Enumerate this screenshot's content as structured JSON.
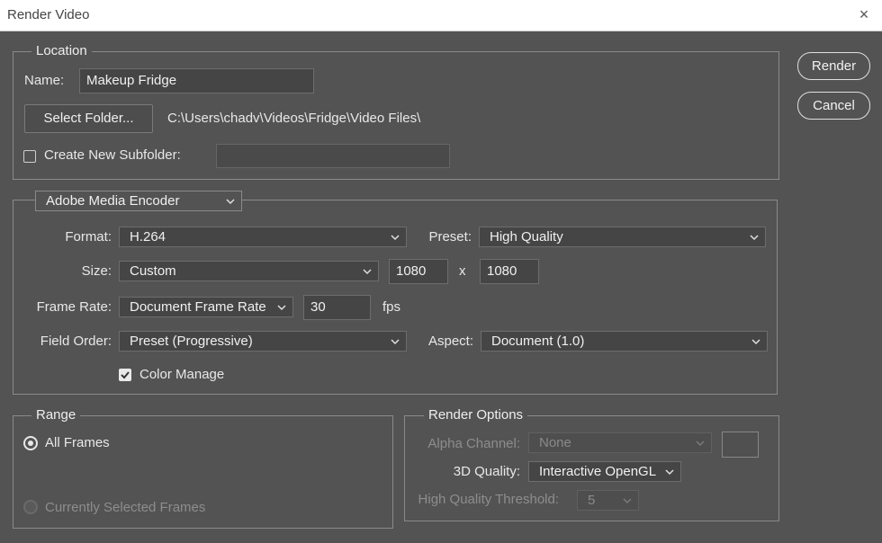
{
  "window": {
    "title": "Render Video",
    "close_glyph": "×"
  },
  "buttons": {
    "render": "Render",
    "cancel": "Cancel"
  },
  "location": {
    "legend": "Location",
    "name_label": "Name:",
    "name_value": "Makeup Fridge",
    "select_folder": "Select Folder...",
    "folder_path": "C:\\Users\\chadv\\Videos\\Fridge\\Video Files\\",
    "subfolder_label": "Create New Subfolder:",
    "subfolder_checked": false,
    "subfolder_value": ""
  },
  "encoder": {
    "selected": "Adobe Media Encoder",
    "format_label": "Format:",
    "format_value": "H.264",
    "preset_label": "Preset:",
    "preset_value": "High Quality",
    "size_label": "Size:",
    "size_value": "Custom",
    "width": "1080",
    "by": "x",
    "height": "1080",
    "frame_rate_label": "Frame Rate:",
    "frame_rate_value": "Document Frame Rate",
    "fps_value": "30",
    "fps_unit": "fps",
    "field_order_label": "Field Order:",
    "field_order_value": "Preset (Progressive)",
    "aspect_label": "Aspect:",
    "aspect_value": "Document (1.0)",
    "color_manage_label": "Color Manage",
    "color_manage_checked": true
  },
  "range": {
    "legend": "Range",
    "all_frames": "All Frames",
    "selected_frames": "Currently Selected Frames",
    "selected_option": "All Frames"
  },
  "render_options": {
    "legend": "Render Options",
    "alpha_label": "Alpha Channel:",
    "alpha_value": "None",
    "quality_label": "3D Quality:",
    "quality_value": "Interactive OpenGL",
    "threshold_label": "High Quality Threshold:",
    "threshold_value": "5"
  },
  "icons": {
    "dropdown": "chevron-down-icon",
    "check": "checkmark-icon",
    "close": "close-icon"
  },
  "colors": {
    "dialog_bg": "#535353",
    "field_bg": "#454545",
    "title_bg": "#ffffff"
  }
}
